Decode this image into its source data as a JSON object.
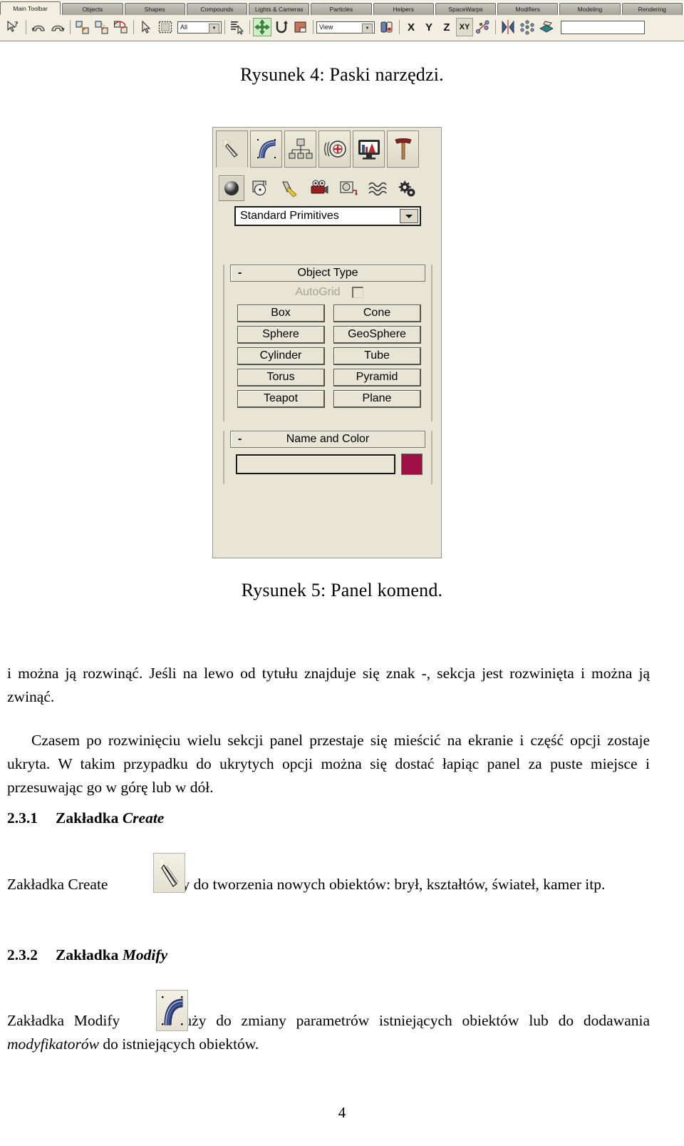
{
  "document": {
    "page_number": "4",
    "language": "pl"
  },
  "figure4": {
    "caption": "Rysunek 4: Paski narzędzi.",
    "toolbar": {
      "tabs": [
        {
          "label": "Main Toolbar",
          "active": true
        },
        {
          "label": "Objects",
          "active": false
        },
        {
          "label": "Shapes",
          "active": false
        },
        {
          "label": "Compounds",
          "active": false
        },
        {
          "label": "Lights & Cameras",
          "active": false
        },
        {
          "label": "Particles",
          "active": false
        },
        {
          "label": "Helpers",
          "active": false
        },
        {
          "label": "SpaceWarps",
          "active": false
        },
        {
          "label": "Modifiers",
          "active": false
        },
        {
          "label": "Modeling",
          "active": false
        },
        {
          "label": "Rendering",
          "active": false
        }
      ],
      "buttons": [
        {
          "icon": "select-and-help-icon",
          "state": "normal"
        },
        {
          "icon": "undo-icon",
          "state": "normal"
        },
        {
          "icon": "redo-icon",
          "state": "normal"
        },
        {
          "icon": "select-and-link-icon",
          "state": "normal"
        },
        {
          "icon": "unlink-selection-icon",
          "state": "normal"
        },
        {
          "icon": "bind-to-space-warp-icon",
          "state": "normal"
        },
        {
          "icon": "select-object-icon",
          "state": "normal"
        },
        {
          "icon": "select-region-icon",
          "state": "normal"
        },
        {
          "icon": "select-by-name-icon",
          "state": "normal"
        },
        {
          "icon": "select-and-move-icon",
          "state": "selected"
        },
        {
          "icon": "select-and-rotate-icon",
          "state": "normal"
        },
        {
          "icon": "select-and-scale-icon",
          "state": "normal"
        },
        {
          "icon": "use-center-icon",
          "state": "normal"
        },
        {
          "icon": "mirror-icon",
          "state": "normal"
        },
        {
          "icon": "align-icon",
          "state": "normal"
        },
        {
          "icon": "layer-manager-icon",
          "state": "normal"
        },
        {
          "icon": "material-editor-icon",
          "state": "normal"
        }
      ],
      "selection_filter": {
        "label": "selection-filter-combo",
        "value": "All"
      },
      "reference_coordinate_system": {
        "label": "reference-coordinate-system-combo",
        "value": "View"
      },
      "axis_constraints": [
        "X",
        "Y",
        "Z",
        "XY"
      ],
      "active_axis": "XY",
      "name_field_value": ""
    }
  },
  "figure5": {
    "caption": "Rysunek 5: Panel komend.",
    "command_panel": {
      "main_tabs": [
        {
          "name": "create-tab",
          "icon": "magic-wand-icon",
          "active": true
        },
        {
          "name": "modify-tab",
          "icon": "bent-tube-icon",
          "active": false
        },
        {
          "name": "hierarchy-tab",
          "icon": "hierarchy-tree-icon",
          "active": false
        },
        {
          "name": "motion-tab",
          "icon": "wheel-motion-icon",
          "active": false
        },
        {
          "name": "display-tab",
          "icon": "monitor-display-icon",
          "active": false
        },
        {
          "name": "utilities-tab",
          "icon": "hammer-icon",
          "active": false
        }
      ],
      "category_buttons": [
        {
          "name": "geometry-button",
          "icon": "sphere-icon",
          "active": true
        },
        {
          "name": "shapes-button",
          "icon": "shapes-icon",
          "active": false
        },
        {
          "name": "lights-button",
          "icon": "light-icon",
          "active": false
        },
        {
          "name": "cameras-button",
          "icon": "camera-icon",
          "active": false
        },
        {
          "name": "helpers-button",
          "icon": "helpers-icon",
          "active": false
        },
        {
          "name": "space-warps-button",
          "icon": "waves-icon",
          "active": false
        },
        {
          "name": "systems-button",
          "icon": "gears-icon",
          "active": false
        }
      ],
      "subcategory_combo": {
        "value": "Standard Primitives"
      },
      "rollouts": [
        {
          "id": "object-type",
          "title": "Object Type",
          "collapse_sign": "-",
          "autogrid": {
            "label": "AutoGrid",
            "checked": false
          },
          "buttons": [
            "Box",
            "Cone",
            "Sphere",
            "GeoSphere",
            "Cylinder",
            "Tube",
            "Torus",
            "Pyramid",
            "Teapot",
            "Plane"
          ]
        },
        {
          "id": "name-and-color",
          "title": "Name and Color",
          "collapse_sign": "-",
          "name_value": "",
          "color_swatch": "#9e0f43"
        }
      ]
    }
  },
  "body": {
    "paragraph1": "i można ją rozwinąć. Jeśli na lewo od tytułu znajduje się znak -, sekcja jest rozwinięta i można ją zwinąć.",
    "paragraph2": "Czasem po rozwinięciu wielu sekcji panel przestaje się mieścić na ekranie i część opcji zostaje ukryta. W takim przypadku do ukrytych opcji można się dostać łapiąc panel za puste miejsce i przesuwając go w górę lub w dół.",
    "section_231": {
      "number": "2.3.1",
      "title_prefix": "Zakładka ",
      "title_italic": "Create",
      "text_before_icon": "Zakładka Create",
      "icon": "create-tab-icon",
      "text_after_icon": "służy do tworzenia nowych obiektów: brył, kształtów, świateł, kamer itp."
    },
    "section_232": {
      "number": "2.3.2",
      "title_prefix": "Zakładka ",
      "title_italic": "Modify",
      "text_before_icon": "Zakładka Modify",
      "icon": "modify-tab-icon",
      "text_after_icon_1": "służy do zmiany parametrów istniejących obiektów lub do dodawania ",
      "italic_word": "modyfikatorów",
      "text_after_icon_2": " do istniejących obiektów."
    }
  },
  "colors": {
    "panel_bg": "#e8e5d6",
    "toolbar_bg": "#f2efe2",
    "active_tool_highlight": "#cdf0c3",
    "object_color_swatch": "#9e0f43"
  }
}
